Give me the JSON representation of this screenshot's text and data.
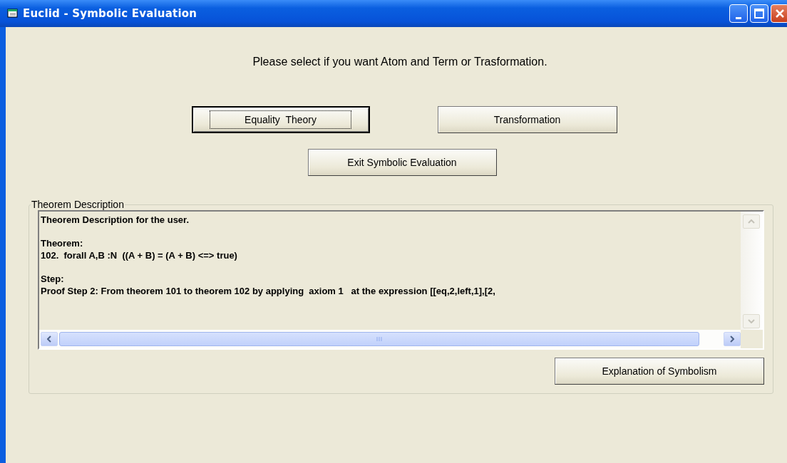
{
  "window": {
    "title": "Euclid - Symbolic Evaluation"
  },
  "prompt": "Please select if you want Atom and Term or Trasformation.",
  "buttons": [
    {
      "label": "Equality  Theory",
      "focused": true
    },
    {
      "label": "Transformation",
      "focused": false
    },
    {
      "label": "Exit Symbolic Evaluation",
      "focused": false
    }
  ],
  "theorem_description": {
    "title": "Theorem Description",
    "paragraphs": [
      [
        "Theorem Description for the user."
      ],
      [
        "Theorem:",
        "102.  forall A,B :N  ((A + B) = (A + B) <=> true)"
      ],
      [
        "Step:",
        "Proof Step 2: From theorem 101 to theorem 102 by applying  axiom 1   at the expression [[eq,2,left,1],[2,"
      ]
    ],
    "button": {
      "label": "Explanation of Symbolism",
      "focused": false
    }
  }
}
